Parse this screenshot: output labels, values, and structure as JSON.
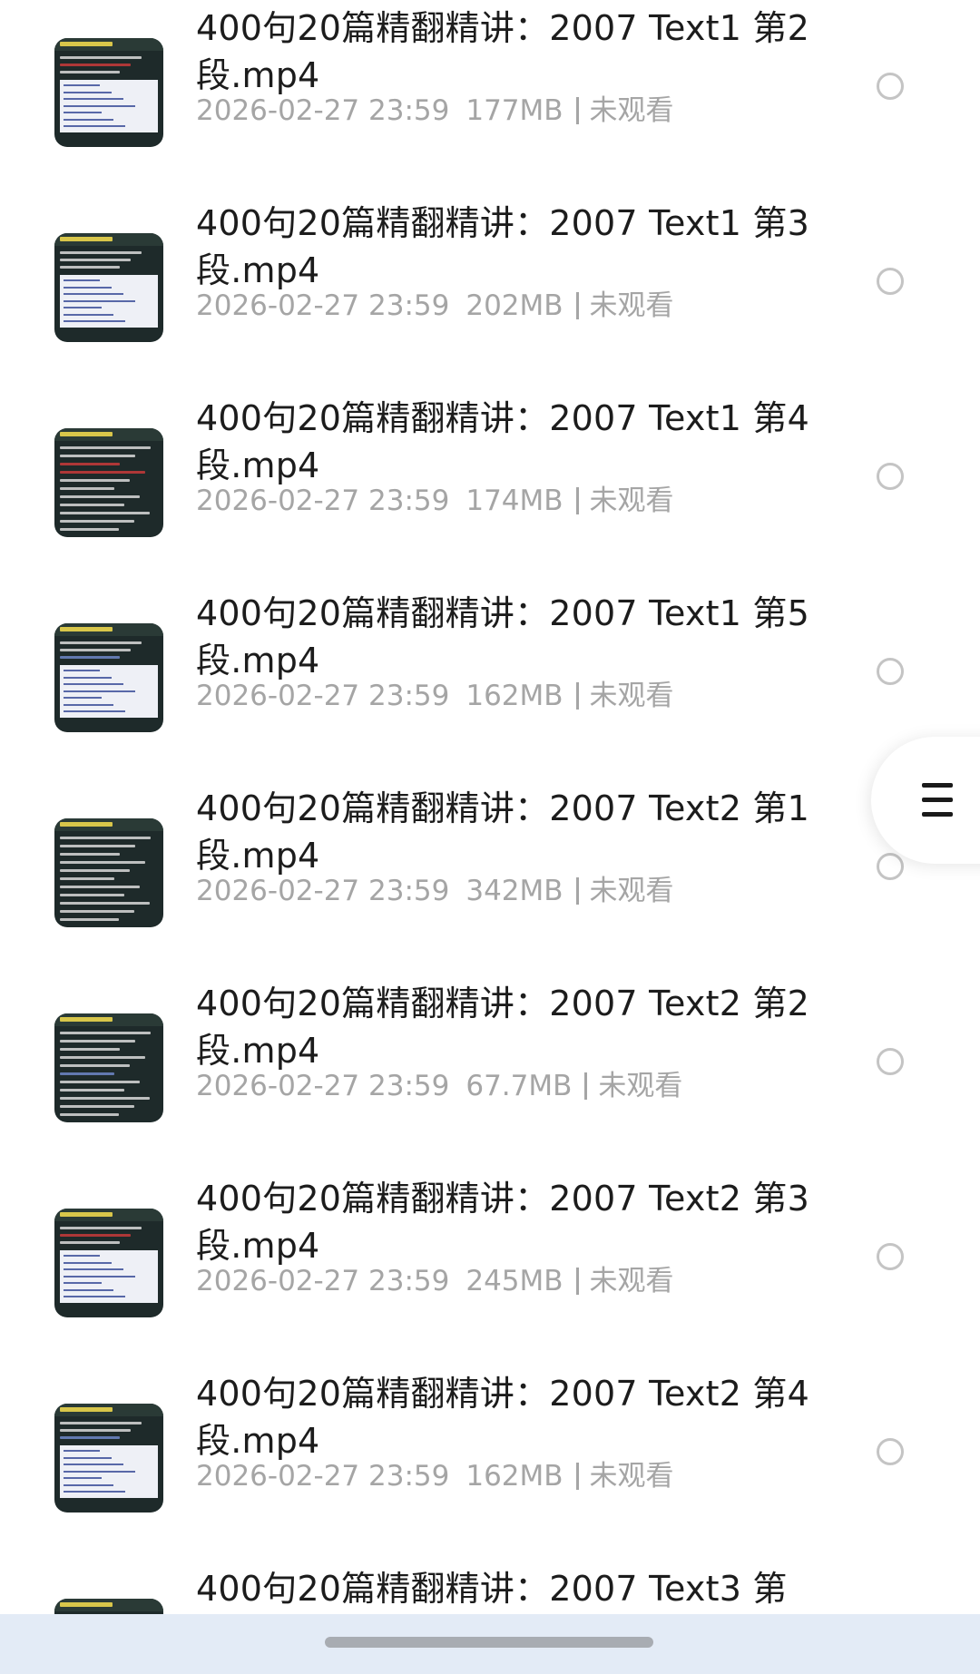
{
  "videos": [
    {
      "title": "400句20篇精翻精讲：2007 Text1 第2段.mp4",
      "date": "2026-02-27 23:59",
      "size": "177MB",
      "status": "未观看"
    },
    {
      "title": "400句20篇精翻精讲：2007 Text1 第3段.mp4",
      "date": "2026-02-27 23:59",
      "size": "202MB",
      "status": "未观看"
    },
    {
      "title": "400句20篇精翻精讲：2007 Text1 第4段.mp4",
      "date": "2026-02-27 23:59",
      "size": "174MB",
      "status": "未观看"
    },
    {
      "title": "400句20篇精翻精讲：2007 Text1 第5段.mp4",
      "date": "2026-02-27 23:59",
      "size": "162MB",
      "status": "未观看"
    },
    {
      "title": "400句20篇精翻精讲：2007 Text2 第1段.mp4",
      "date": "2026-02-27 23:59",
      "size": "342MB",
      "status": "未观看"
    },
    {
      "title": "400句20篇精翻精讲：2007 Text2 第2段.mp4",
      "date": "2026-02-27 23:59",
      "size": "67.7MB",
      "status": "未观看"
    },
    {
      "title": "400句20篇精翻精讲：2007 Text2 第3段.mp4",
      "date": "2026-02-27 23:59",
      "size": "245MB",
      "status": "未观看"
    },
    {
      "title": "400句20篇精翻精讲：2007 Text2 第4段.mp4",
      "date": "2026-02-27 23:59",
      "size": "162MB",
      "status": "未观看"
    },
    {
      "title": "400句20篇精翻精讲：2007 Text3 第",
      "date": "",
      "size": "",
      "status": ""
    }
  ],
  "icons": {
    "radio": "radio-unchecked-icon",
    "menu": "hamburger-menu-icon"
  },
  "colors": {
    "title": "#1c1c1c",
    "meta": "#a5a5a5",
    "radio_border": "#c4c4c4",
    "bottom_bar": "#e3ebf6"
  }
}
